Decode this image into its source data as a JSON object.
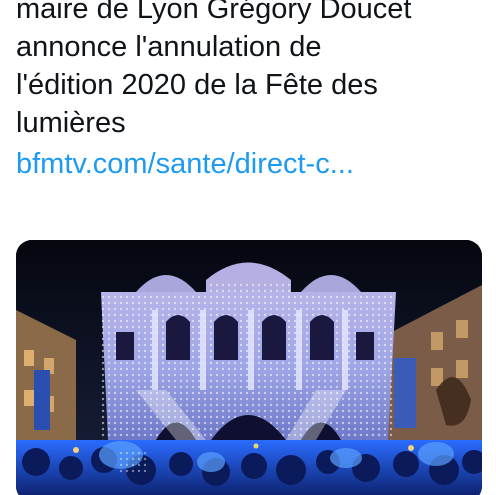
{
  "tweet": {
    "text_lines": [
      "maire de Lyon Grégory Doucet",
      "annonce l'annulation de",
      "l'édition 2020 de la Fête des",
      "lumières"
    ],
    "link": "bfmtv.com/sante/direct-c..."
  },
  "media": {
    "kind": "photo",
    "subject": "illuminated-theatre-facade"
  },
  "colors": {
    "text": "#0f1419",
    "link": "#1d9bf0",
    "sky": "#0a0e1a",
    "light": "#c9d4ff",
    "crowd": "#1a3fb0"
  }
}
